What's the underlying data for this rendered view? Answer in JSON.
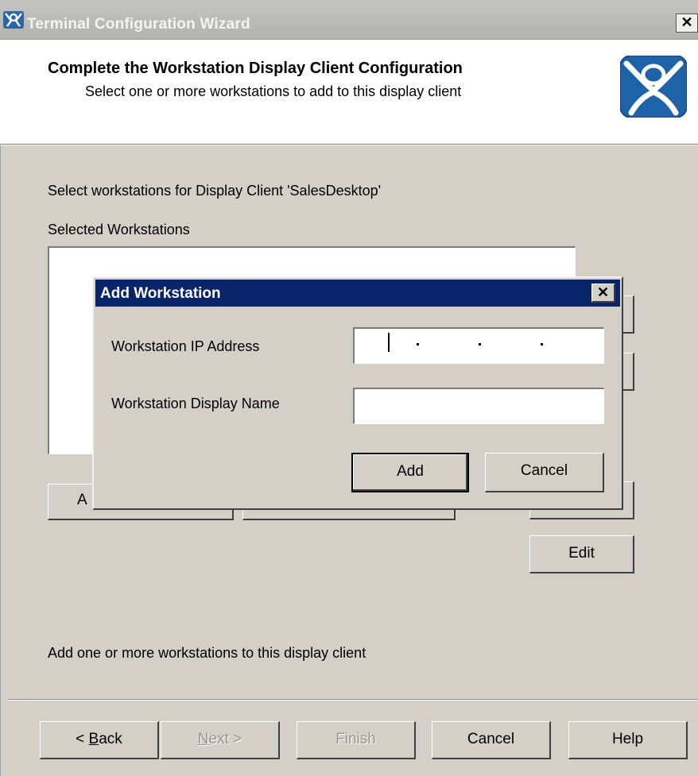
{
  "window": {
    "title": "Terminal Configuration Wizard",
    "close_glyph": "✕"
  },
  "header": {
    "title": "Complete the Workstation Display Client Configuration",
    "subtitle": "Select one or more workstations to add to this display client"
  },
  "body": {
    "instruction": "Select workstations for Display Client 'SalesDesktop'",
    "list_label": "Selected Workstations",
    "side_buttons": {
      "edit_label": "Edit"
    },
    "bottom_partial_button_char": "A",
    "footer_hint": "Add one or more workstations to this display client"
  },
  "nav": {
    "back_prefix": "< ",
    "back_mnemonic": "B",
    "back_rest": "ack",
    "next_mnemonic": "N",
    "next_rest": "ext >",
    "finish_label": "Finish",
    "cancel_label": "Cancel",
    "help_label": "Help"
  },
  "dialog": {
    "title": "Add Workstation",
    "close_glyph": "✕",
    "ip_label": "Workstation IP Address",
    "ip_value": "",
    "display_name_label": "Workstation Display Name",
    "display_name_value": "",
    "add_label": "Add",
    "cancel_label": "Cancel"
  },
  "colors": {
    "dialog_titlebar": "#0a246a",
    "face": "#d4d0c8",
    "brand_blue": "#1f62a8"
  },
  "icons": {
    "app": "terminal-config-app-icon",
    "brand": "user-profile-logo-icon"
  }
}
